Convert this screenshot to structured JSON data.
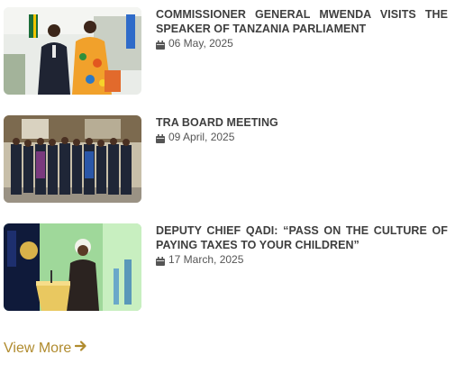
{
  "news": [
    {
      "title": "COMMISSIONER GENERAL MWENDA VISITS THE SPEAKER OF TANZANIA PARLIAMENT",
      "date": "06 May, 2025"
    },
    {
      "title": "TRA BOARD MEETING",
      "date": "09 April, 2025"
    },
    {
      "title": "DEPUTY CHIEF QADI: “PASS ON THE CULTURE OF PAYING TAXES TO YOUR CHILDREN”",
      "date": "17 March, 2025"
    }
  ],
  "view_more": {
    "label": "View More",
    "icon": "arrow-right-icon"
  },
  "colors": {
    "title": "#3e3e3e",
    "accent": "#b08b2e"
  }
}
